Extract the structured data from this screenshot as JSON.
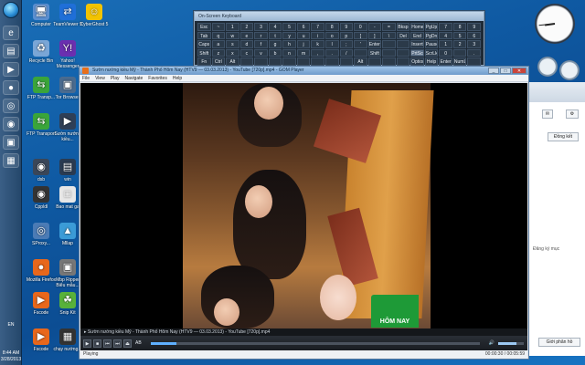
{
  "desktop_icons": [
    {
      "id": "computer",
      "label": "Computer",
      "glyph": "🖥",
      "color": "#5b8fd0"
    },
    {
      "id": "teamviewer",
      "label": "TeamViewer 9",
      "glyph": "⇄",
      "color": "#1f6fd8"
    },
    {
      "id": "cybershot",
      "label": "CyberGhost 5",
      "glyph": "☺",
      "color": "#f2c300"
    },
    {
      "id": "recycle",
      "label": "Recycle Bin",
      "glyph": "♻",
      "color": "#7aa6d6"
    },
    {
      "id": "yahoo",
      "label": "Yahoo! Messenger",
      "glyph": "Y!",
      "color": "#6b2fb0"
    },
    {
      "id": "ftp-transport",
      "label": "FTP Transp...",
      "glyph": "⇆",
      "color": "#3aa53a"
    },
    {
      "id": "tor",
      "label": "Tor Browser",
      "glyph": "▣",
      "color": "#4a6b8f"
    },
    {
      "id": "ftp-transport-2",
      "label": "FTP Transport",
      "glyph": "⇆",
      "color": "#3aa53a"
    },
    {
      "id": "suthu",
      "label": "Sườn nướng kiều...",
      "glyph": "▶",
      "color": "#2f3f56"
    },
    {
      "id": "lead-large",
      "label": "lead_large",
      "glyph": "■",
      "color": "#222"
    },
    {
      "id": "dsb",
      "label": "dsb",
      "glyph": "◉",
      "color": "#3a4658"
    },
    {
      "id": "win",
      "label": "win",
      "glyph": "▤",
      "color": "#2a3b52"
    },
    {
      "id": "cppldl",
      "label": "Cppldl",
      "glyph": "◉",
      "color": "#333"
    },
    {
      "id": "baomsg",
      "label": "Bao mat ga",
      "glyph": "□",
      "color": "#e7e7e7"
    },
    {
      "id": "sproxy",
      "label": "SProxy...",
      "glyph": "◎",
      "color": "#4b7bb5"
    },
    {
      "id": "mlsp",
      "label": "Mllap",
      "glyph": "▲",
      "color": "#3b9bd7"
    },
    {
      "id": "mozilla",
      "label": "Mozilla Firefox",
      "glyph": "●",
      "color": "#e8671b"
    },
    {
      "id": "mbp",
      "label": "Mbp Ripper Biểu mẫu...",
      "glyph": "▣",
      "color": "#777"
    },
    {
      "id": "fscode",
      "label": "Fscode",
      "glyph": "▶",
      "color": "#e8671b"
    },
    {
      "id": "plant",
      "label": "Snip Kit",
      "glyph": "☘",
      "color": "#58b13a"
    },
    {
      "id": "fscode2",
      "label": "Fscode",
      "glyph": "▶",
      "color": "#e8671b"
    },
    {
      "id": "chan",
      "label": "chạy nướng...",
      "glyph": "▦",
      "color": "#333"
    }
  ],
  "taskbar": {
    "tray_lang": "EN",
    "time": "8:44 AM",
    "date": "3/28/2013"
  },
  "osk": {
    "title": "On-Screen Keyboard",
    "keys": [
      "Esc",
      "~",
      "1",
      "2",
      "3",
      "4",
      "5",
      "6",
      "7",
      "8",
      "9",
      "0",
      "-",
      "=",
      "Bksp",
      "Home",
      "PgUp",
      "7",
      "8",
      "9",
      "Tab",
      "q",
      "w",
      "e",
      "r",
      "t",
      "y",
      "u",
      "i",
      "o",
      "p",
      "[",
      "]",
      "\\",
      "Del",
      "End",
      "PgDn",
      "4",
      "5",
      "6",
      "Caps",
      "a",
      "s",
      "d",
      "f",
      "g",
      "h",
      "j",
      "k",
      "l",
      ";",
      "'",
      "Enter",
      "",
      "",
      "Insert",
      "Pause",
      "1",
      "2",
      "3",
      "Shift",
      "z",
      "x",
      "c",
      "v",
      "b",
      "n",
      "m",
      ",",
      ".",
      "/",
      "",
      "Shift",
      "",
      "",
      "PrtScn",
      "ScrLk",
      "0",
      "",
      ".",
      "Fn",
      "Ctrl",
      "Alt",
      "",
      "",
      "",
      "",
      "",
      "",
      "",
      "",
      "Alt",
      "",
      "",
      "",
      "Options",
      "Help",
      "Enter",
      "NumLock",
      ""
    ]
  },
  "player": {
    "title": "Sườn nướng kiều Mỹ - Thành Phố Hôm Nay (HTV9 — 03.03.2013) - YouTube [720p].mp4 - GOM Player",
    "menu": [
      "File",
      "View",
      "Play",
      "Navigate",
      "Favorites",
      "Help"
    ],
    "caption": "Sườn nướng kiều Mỹ - Thành Phố Hôm Nay (HTV9 — 03.03.2013) - YouTube [720p].mp4",
    "controls": {
      "play": "▶",
      "stop": "■",
      "prev": "⏮",
      "next": "⏭",
      "open": "⏏",
      "ab": "AB"
    },
    "status": "Playing",
    "time": "00:00:30 / 00:05:59",
    "progress": 0.08,
    "volume": 0.7,
    "channel_logo": "HÔM NAY"
  },
  "browser": {
    "btn_send": "Đồng kết",
    "btn_bottom": "Giới phân hồ",
    "text": "Đăng ký mục"
  },
  "clock": {
    "hour": 8,
    "minute": 44
  }
}
